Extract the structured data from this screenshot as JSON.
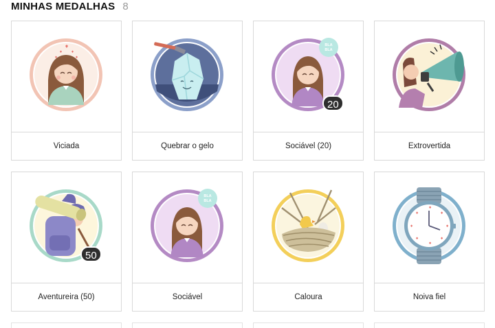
{
  "header": {
    "title": "MINHAS MEDALHAS",
    "count": "8"
  },
  "medals": [
    {
      "label": "Viciada"
    },
    {
      "label": "Quebrar o gelo"
    },
    {
      "label": "Sociável (20)",
      "badge": "20",
      "bubble": "BLA BLA"
    },
    {
      "label": "Extrovertida"
    },
    {
      "label": "Aventureira (50)",
      "badge": "50"
    },
    {
      "label": "Sociável",
      "bubble": "BLA BLA"
    },
    {
      "label": "Caloura"
    },
    {
      "label": "Noiva fiel"
    }
  ],
  "colors": {
    "viciada_ring": "#f2c4b4",
    "gelo_ring": "#8b9fc9",
    "sociavel_ring": "#b48ac4",
    "extrovertida_ring": "#b07da8",
    "aventureira_ring": "#a8d9c8",
    "caloura_ring": "#f3cf5a",
    "noiva_ring": "#7fb0cc",
    "badge_bg": "#2e2e2e"
  }
}
